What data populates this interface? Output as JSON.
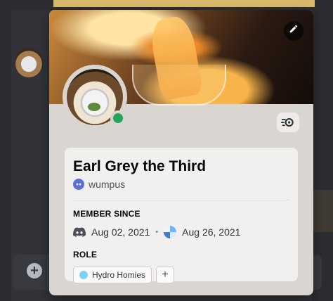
{
  "profile": {
    "display_name": "Earl Grey the Third",
    "username": "wumpus",
    "edit_icon": "pencil-icon",
    "status": "online",
    "status_color": "#23a55a",
    "nitro_badge_icon": "nitro-icon"
  },
  "member_since": {
    "title": "MEMBER SINCE",
    "discord_date": "Aug 02, 2021",
    "separator": "•",
    "server_date": "Aug 26, 2021"
  },
  "role": {
    "title": "ROLE",
    "items": [
      {
        "label": "Hydro Homies",
        "color": "#7dd3f5"
      }
    ],
    "add_symbol": "+"
  },
  "chat": {
    "add_symbol": "+"
  }
}
